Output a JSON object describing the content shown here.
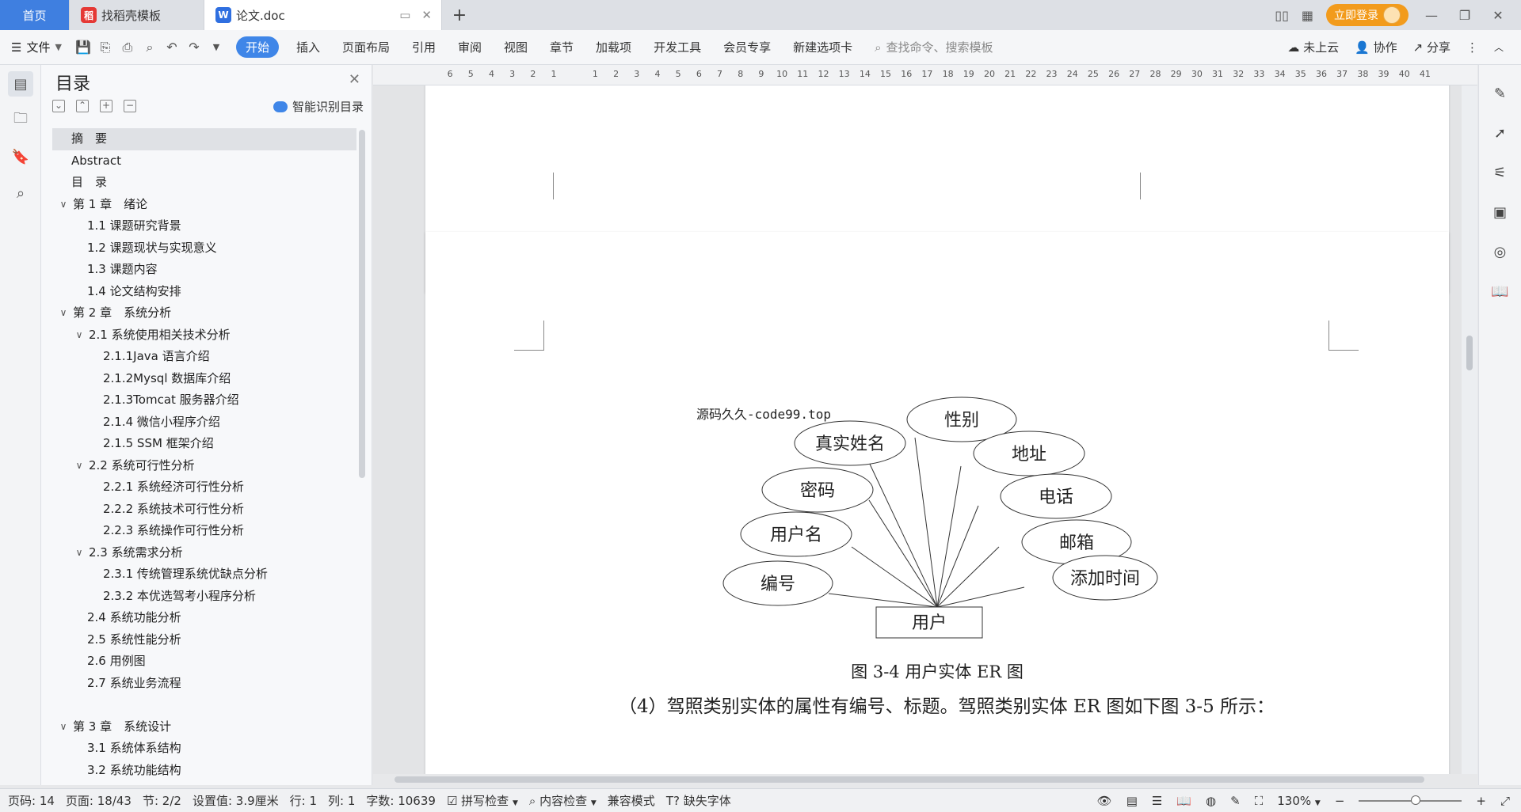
{
  "tabs": {
    "home": "首页",
    "template": "找稻壳模板",
    "doc": "论文.doc"
  },
  "titlebar": {
    "login": "立即登录"
  },
  "menu": {
    "file": "文件",
    "items": [
      "开始",
      "插入",
      "页面布局",
      "引用",
      "审阅",
      "视图",
      "章节",
      "加载项",
      "开发工具",
      "会员专享",
      "新建选项卡"
    ],
    "search_placeholder": "查找命令、搜索模板",
    "cloud": "未上云",
    "collab": "协作",
    "share": "分享"
  },
  "toc": {
    "title": "目录",
    "smart": "智能识别目录",
    "items": [
      {
        "text": "摘　要",
        "level": 0
      },
      {
        "text": "Abstract",
        "level": 0
      },
      {
        "text": "目　录",
        "level": 0
      },
      {
        "text": "第 1 章　绪论",
        "level": 0,
        "expanded": true
      },
      {
        "text": "1.1 课题研究背景",
        "level": 1
      },
      {
        "text": "1.2 课题现状与实现意义",
        "level": 1
      },
      {
        "text": "1.3 课题内容",
        "level": 1
      },
      {
        "text": "1.4 论文结构安排",
        "level": 1
      },
      {
        "text": "第 2 章　系统分析",
        "level": 0,
        "expanded": true
      },
      {
        "text": "2.1 系统使用相关技术分析",
        "level": 1,
        "expanded": true
      },
      {
        "text": "2.1.1Java 语言介绍",
        "level": 2
      },
      {
        "text": "2.1.2Mysql 数据库介绍",
        "level": 2
      },
      {
        "text": "2.1.3Tomcat 服务器介绍",
        "level": 2
      },
      {
        "text": "2.1.4 微信小程序介绍",
        "level": 2
      },
      {
        "text": "2.1.5 SSM 框架介绍",
        "level": 2
      },
      {
        "text": "2.2 系统可行性分析",
        "level": 1,
        "expanded": true
      },
      {
        "text": "2.2.1 系统经济可行性分析",
        "level": 2
      },
      {
        "text": "2.2.2 系统技术可行性分析",
        "level": 2
      },
      {
        "text": "2.2.3 系统操作可行性分析",
        "level": 2
      },
      {
        "text": "2.3 系统需求分析",
        "level": 1,
        "expanded": true
      },
      {
        "text": "2.3.1 传统管理系统优缺点分析",
        "level": 2
      },
      {
        "text": "2.3.2 本优选驾考小程序分析",
        "level": 2
      },
      {
        "text": "2.4 系统功能分析",
        "level": 1
      },
      {
        "text": "2.5 系统性能分析",
        "level": 1
      },
      {
        "text": "2.6 用例图",
        "level": 1
      },
      {
        "text": "2.7 系统业务流程",
        "level": 1
      },
      {
        "text": "",
        "level": -1
      },
      {
        "text": "第 3 章　系统设计",
        "level": 0,
        "expanded": true
      },
      {
        "text": "3.1 系统体系结构",
        "level": 1
      },
      {
        "text": "3.2 系统功能结构",
        "level": 1
      }
    ]
  },
  "ruler": {
    "numbers": [
      "6",
      "5",
      "4",
      "3",
      "2",
      "1",
      "",
      "1",
      "2",
      "3",
      "4",
      "5",
      "6",
      "7",
      "8",
      "9",
      "10",
      "11",
      "12",
      "13",
      "14",
      "15",
      "16",
      "17",
      "18",
      "19",
      "20",
      "21",
      "22",
      "23",
      "24",
      "25",
      "26",
      "27",
      "28",
      "29",
      "30",
      "31",
      "32",
      "33",
      "34",
      "35",
      "36",
      "37",
      "38",
      "39",
      "40",
      "41"
    ]
  },
  "document": {
    "watermark": "源码久久-code99.top",
    "entity": "用户",
    "attributes": [
      "性别",
      "真实姓名",
      "地址",
      "密码",
      "电话",
      "用户名",
      "邮箱",
      "编号",
      "添加时间"
    ],
    "caption": "图 3-4 用户实体 ER 图",
    "paragraph": "（4）驾照类别实体的属性有编号、标题。驾照类别实体 ER 图如下图 3-5 所示："
  },
  "status": {
    "page_num": "页码: 14",
    "page": "页面: 18/43",
    "section": "节: 2/2",
    "setting": "设置值: 3.9厘米",
    "row": "行: 1",
    "col": "列: 1",
    "words": "字数: 10639",
    "spell": "拼写检查",
    "content_check": "内容检查",
    "compat": "兼容模式",
    "missing_font": "缺失字体",
    "zoom": "130%",
    "zoom_level": 0.55
  }
}
